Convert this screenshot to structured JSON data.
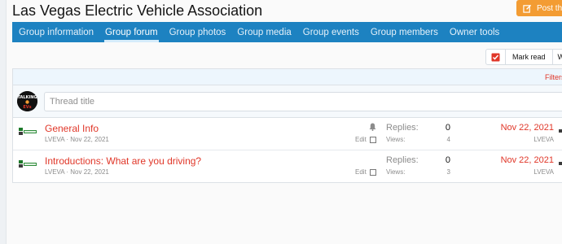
{
  "page": {
    "title": "Las Vegas Electric Vehicle Association",
    "post_button": "Post thread",
    "colors": {
      "nav_bg": "#1d82c1",
      "accent_orange": "#f39c33",
      "link_red": "#e03628",
      "filter_bar_bg": "#edf6fd"
    }
  },
  "nav": {
    "tabs": [
      {
        "label": "Group information",
        "active": false
      },
      {
        "label": "Group forum",
        "active": true
      },
      {
        "label": "Group photos",
        "active": false
      },
      {
        "label": "Group media",
        "active": false
      },
      {
        "label": "Group events",
        "active": false
      },
      {
        "label": "Group members",
        "active": false
      },
      {
        "label": "Owner tools",
        "active": false
      }
    ]
  },
  "actions": {
    "checkbox_icon": "checkbox-checked-icon",
    "mark_read": "Mark read",
    "watch": "Watch"
  },
  "filters": {
    "label": "Filters"
  },
  "quick_thread": {
    "avatar_icon": "talking-evs-avatar",
    "placeholder": "Thread title"
  },
  "threads": [
    {
      "title": "General Info",
      "author": "LVEVA",
      "date": "Nov 22, 2021",
      "meta": "LVEVA · Nov 22, 2021",
      "edit_label": "Edit",
      "replies_label": "Replies:",
      "replies": "0",
      "views_label": "Views:",
      "views": "4",
      "last_date": "Nov 22, 2021",
      "last_user": "LVEVA",
      "has_bell": true
    },
    {
      "title": "Introductions: What are you driving?",
      "author": "LVEVA",
      "date": "Nov 22, 2021",
      "meta": "LVEVA · Nov 22, 2021",
      "edit_label": "Edit",
      "replies_label": "Replies:",
      "replies": "0",
      "views_label": "Views:",
      "views": "3",
      "last_date": "Nov 22, 2021",
      "last_user": "LVEVA",
      "has_bell": false
    }
  ]
}
